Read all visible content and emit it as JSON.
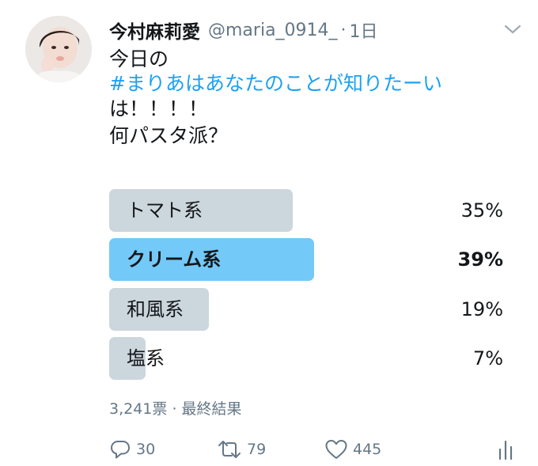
{
  "tweet": {
    "display_name": "今村麻莉愛",
    "handle": "@maria_0914_",
    "separator": "·",
    "time": "1日",
    "lines": {
      "line1": "今日の",
      "hashtag": "#まりあはあなたのことが知りたーい",
      "line3": "は！！！！",
      "line4": "何パスタ派？"
    }
  },
  "poll": {
    "options": [
      {
        "label": "トマト系",
        "percent_text": "35%",
        "share": 0.35,
        "winner": false
      },
      {
        "label": "クリーム系",
        "percent_text": "39%",
        "share": 0.39,
        "winner": true
      },
      {
        "label": "和風系",
        "percent_text": "19%",
        "share": 0.19,
        "winner": false
      },
      {
        "label": "塩系",
        "percent_text": "7%",
        "share": 0.07,
        "winner": false
      }
    ],
    "votes": "3,241票",
    "dot": "·",
    "status": "最終結果"
  },
  "actions": {
    "replies": "30",
    "retweets": "79",
    "likes": "445"
  },
  "colors": {
    "accent": "#1da1f2",
    "bar": "#ccd6dd",
    "winner_bar": "#73c9f7",
    "muted": "#657786"
  },
  "icons": [
    "reply-icon",
    "retweet-icon",
    "like-icon",
    "analytics-icon",
    "chevron-down-icon"
  ]
}
